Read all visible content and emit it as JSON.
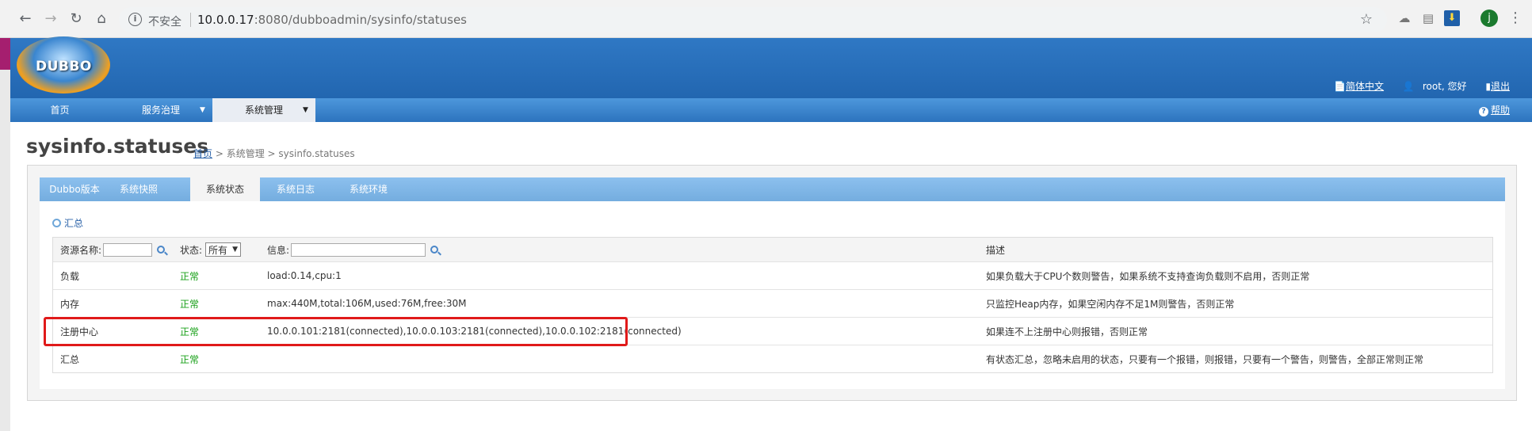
{
  "browser": {
    "back_icon": "back-arrow-icon",
    "forward_icon": "forward-arrow-icon",
    "reload_icon": "reload-icon",
    "home_icon": "home-icon",
    "security_label": "不安全",
    "url_host": "10.0.0.17",
    "url_rest": ":8080/dubboadmin/sysinfo/statuses",
    "profile_initial": "j"
  },
  "header": {
    "logo_text": "DUBBO",
    "language_link": "简体中文",
    "greeting": "root, 您好",
    "logout_link": "退出"
  },
  "menu": {
    "items": [
      {
        "label": "首页"
      },
      {
        "label": "服务治理"
      },
      {
        "label": "系统管理"
      }
    ],
    "arrow": "▼",
    "help": "帮助"
  },
  "page": {
    "title": "sysinfo.statuses",
    "breadcrumb": {
      "home": "首页",
      "sep1": " > ",
      "section": "系统管理",
      "sep2": " > ",
      "current": "sysinfo.statuses"
    }
  },
  "tabs": [
    {
      "label": "Dubbo版本"
    },
    {
      "label": "系统快照"
    },
    {
      "label": "系统状态"
    },
    {
      "label": "系统日志"
    },
    {
      "label": "系统环境"
    }
  ],
  "summary_link": "汇总",
  "table": {
    "header": {
      "resource_label": "资源名称:",
      "status_label": "状态:",
      "status_select": "所有",
      "info_label": "信息:",
      "desc_label": "描述"
    },
    "rows": [
      {
        "name": "负载",
        "status": "正常",
        "info": "load:0.14,cpu:1",
        "desc": "如果负载大于CPU个数则警告，如果系统不支持查询负载则不启用，否则正常"
      },
      {
        "name": "内存",
        "status": "正常",
        "info": "max:440M,total:106M,used:76M,free:30M",
        "desc": "只监控Heap内存，如果空闲内存不足1M则警告，否则正常"
      },
      {
        "name": "注册中心",
        "status": "正常",
        "info": "10.0.0.101:2181(connected),10.0.0.103:2181(connected),10.0.0.102:2181(connected)",
        "desc": "如果连不上注册中心则报错，否则正常"
      },
      {
        "name": "汇总",
        "status": "正常",
        "info": "",
        "desc": "有状态汇总，忽略未启用的状态，只要有一个报错，则报错，只要有一个警告，则警告，全部正常则正常"
      }
    ]
  },
  "colors": {
    "banner": "#2266b0",
    "menubar": "#2c73be",
    "tabs": "#74addf",
    "status_ok": "#18a018",
    "highlight": "#e01a1a"
  }
}
